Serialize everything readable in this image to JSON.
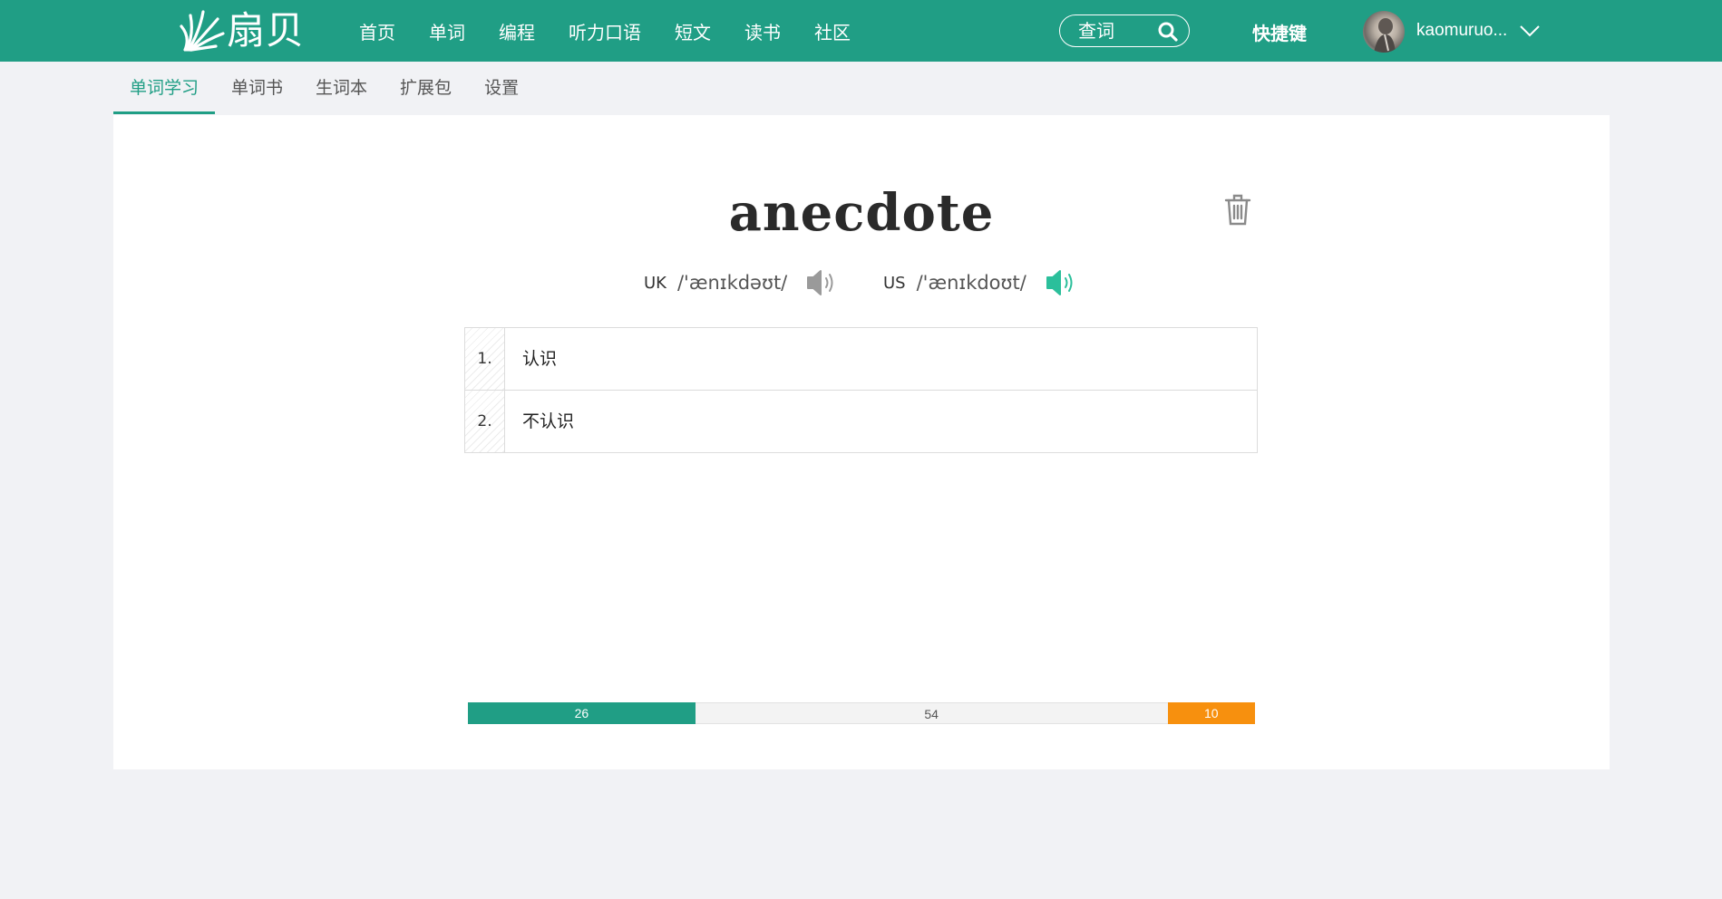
{
  "header": {
    "logo_text": "扇贝",
    "nav": [
      "首页",
      "单词",
      "编程",
      "听力口语",
      "短文",
      "读书",
      "社区"
    ],
    "search_placeholder": "查词",
    "shortcut_label": "快捷键",
    "username": "kaomuruo..."
  },
  "subtabs": [
    {
      "label": "单词学习",
      "active": true
    },
    {
      "label": "单词书",
      "active": false
    },
    {
      "label": "生词本",
      "active": false
    },
    {
      "label": "扩展包",
      "active": false
    },
    {
      "label": "设置",
      "active": false
    }
  ],
  "word": {
    "text": "anecdote",
    "uk_label": "UK",
    "uk_ipa": "/'ænɪkdəʊt/",
    "us_label": "US",
    "us_ipa": "/'ænɪkdoʊt/"
  },
  "options": [
    {
      "num": "1.",
      "text": "认识"
    },
    {
      "num": "2.",
      "text": "不认识"
    }
  ],
  "progress": {
    "done": 26,
    "remaining": 54,
    "review": 10
  },
  "colors": {
    "brand": "#209e85",
    "review": "#f7900e",
    "speaker_active": "#2bbf9b",
    "speaker_inactive": "#9a9a9a"
  }
}
